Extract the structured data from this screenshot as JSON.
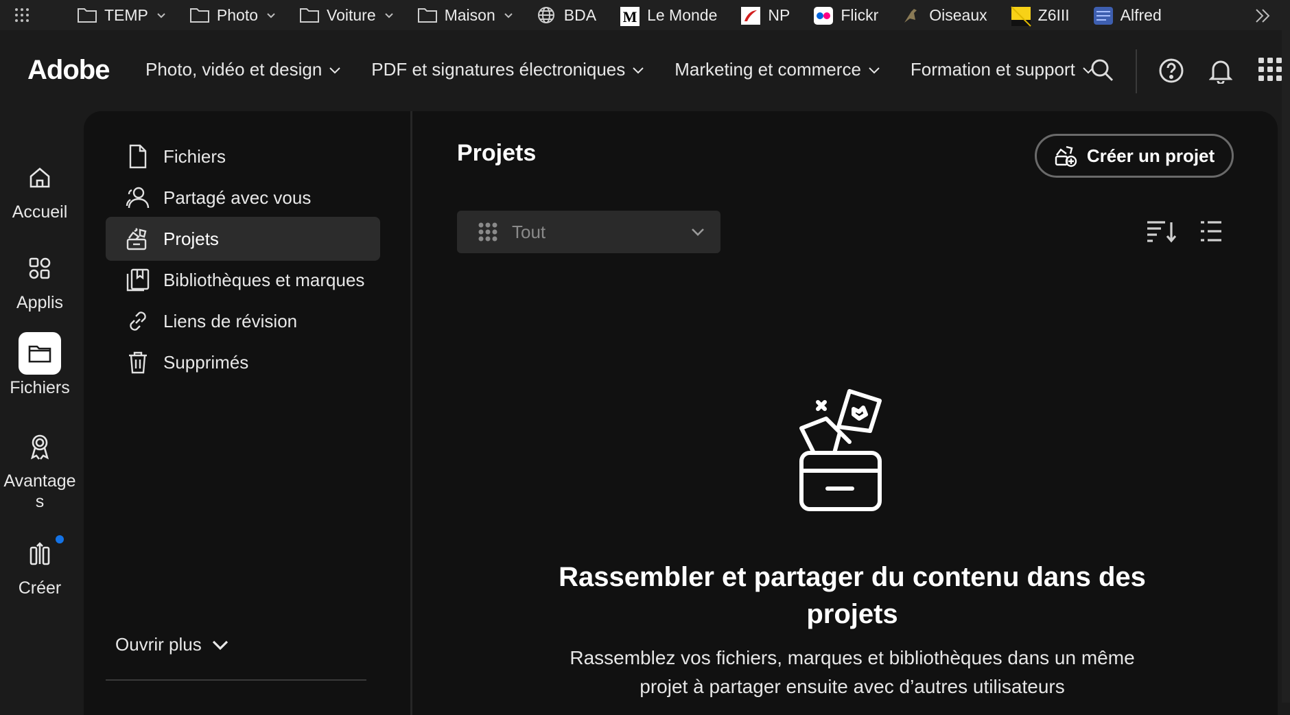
{
  "bookmarks": {
    "items": [
      {
        "label": "TEMP",
        "icon": "folder-icon",
        "has_menu": true
      },
      {
        "label": "Photo",
        "icon": "folder-icon",
        "has_menu": true
      },
      {
        "label": "Voiture",
        "icon": "folder-icon",
        "has_menu": true
      },
      {
        "label": "Maison",
        "icon": "folder-icon",
        "has_menu": true
      },
      {
        "label": "BDA",
        "icon": "globe-icon",
        "has_menu": false
      },
      {
        "label": "Le Monde",
        "icon": "le-monde-icon",
        "has_menu": false
      },
      {
        "label": "NP",
        "icon": "np-icon",
        "has_menu": false
      },
      {
        "label": "Flickr",
        "icon": "flickr-icon",
        "has_menu": false
      },
      {
        "label": "Oiseaux",
        "icon": "bird-icon",
        "has_menu": false
      },
      {
        "label": "Z6III",
        "icon": "nikon-icon",
        "has_menu": false
      },
      {
        "label": "Alfred",
        "icon": "alfred-icon",
        "has_menu": false
      }
    ]
  },
  "header": {
    "logo": "Adobe",
    "nav": [
      {
        "label": "Photo, vidéo et design"
      },
      {
        "label": "PDF et signatures électroniques"
      },
      {
        "label": "Marketing et commerce"
      },
      {
        "label": "Formation et support"
      }
    ]
  },
  "rail": {
    "items": [
      {
        "label": "Accueil",
        "icon": "home-icon"
      },
      {
        "label": "Applis",
        "icon": "apps-icon"
      },
      {
        "label": "Fichiers",
        "icon": "folder-icon",
        "active": true
      },
      {
        "label": "Avantage\ns",
        "icon": "award-icon"
      },
      {
        "label": "Créer",
        "icon": "create-icon"
      }
    ]
  },
  "subnav": {
    "items": [
      {
        "label": "Fichiers",
        "icon": "file-icon"
      },
      {
        "label": "Partagé avec vous",
        "icon": "shared-icon"
      },
      {
        "label": "Projets",
        "icon": "projects-icon",
        "active": true
      },
      {
        "label": "Bibliothèques et marques",
        "icon": "library-icon"
      },
      {
        "label": "Liens de révision",
        "icon": "link-icon"
      },
      {
        "label": "Supprimés",
        "icon": "trash-icon"
      }
    ],
    "open_more": "Ouvrir plus"
  },
  "main": {
    "title": "Projets",
    "create_button": "Créer un projet",
    "filter_value": "Tout",
    "empty_title": "Rassembler et partager du contenu dans des projets",
    "empty_description": "Rassemblez vos fichiers, marques et bibliothèques dans un même projet à partager ensuite avec d’autres utilisateurs"
  },
  "colors": {
    "background": "#1b1b1b",
    "panel": "#111111",
    "accent_dot": "#1473e6",
    "active_item": "#2c2c2c"
  }
}
